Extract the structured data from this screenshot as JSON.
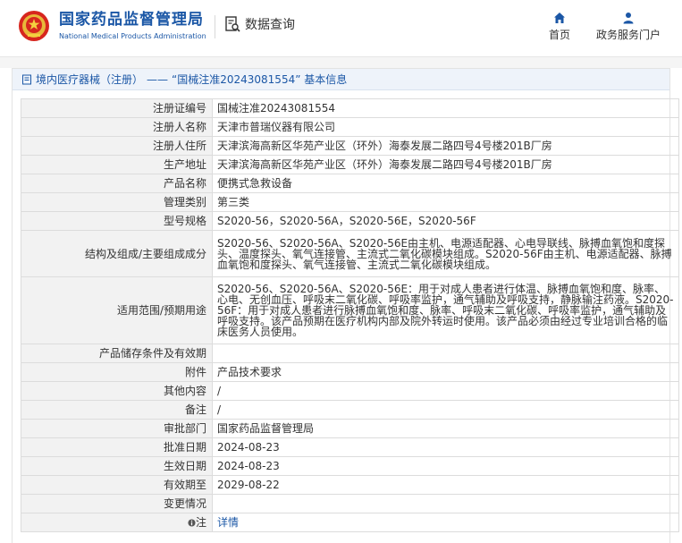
{
  "header": {
    "site_name_cn": "国家药品监督管理局",
    "site_name_en": "National Medical Products Administration",
    "query_label": "数据查询",
    "nav": [
      {
        "label": "首页",
        "icon": "home-icon"
      },
      {
        "label": "政务服务门户",
        "icon": "user-icon"
      }
    ],
    "brand_color": "#1b57a6"
  },
  "breadcrumb": {
    "category": "境内医疗器械（注册）",
    "separator": "——",
    "title": "“国械注准20243081554” 基本信息"
  },
  "record": {
    "rows": [
      {
        "label": "注册证编号",
        "value": "国械注准20243081554"
      },
      {
        "label": "注册人名称",
        "value": "天津市普瑞仪器有限公司"
      },
      {
        "label": "注册人住所",
        "value": "天津滨海高新区华苑产业区（环外）海泰发展二路四号4号楼201B厂房"
      },
      {
        "label": "生产地址",
        "value": "天津滨海高新区华苑产业区（环外）海泰发展二路四号4号楼201B厂房"
      },
      {
        "label": "产品名称",
        "value": "便携式急救设备"
      },
      {
        "label": "管理类别",
        "value": "第三类"
      },
      {
        "label": "型号规格",
        "value": "S2020-56，S2020-56A，S2020-56E，S2020-56F"
      },
      {
        "label": "结构及组成/主要组成成分",
        "value": "S2020-56、S2020-56A、S2020-56E由主机、电源适配器、心电导联线、脉搏血氧饱和度探头、温度探头、氧气连接管、主流式二氧化碳模块组成。S2020-56F由主机、电源适配器、脉搏血氧饱和度探头、氧气连接管、主流式二氧化碳模块组成。"
      },
      {
        "label": "适用范围/预期用途",
        "value": "S2020-56、S2020-56A、S2020-56E：用于对成人患者进行体温、脉搏血氧饱和度、脉率、心电、无创血压、呼吸末二氧化碳、呼吸率监护，通气辅助及呼吸支持，静脉输注药液。S2020-56F：用于对成人患者进行脉搏血氧饱和度、脉率、呼吸末二氧化碳、呼吸率监护，通气辅助及呼吸支持。该产品预期在医疗机构内部及院外转运时使用。该产品必须由经过专业培训合格的临床医务人员使用。"
      },
      {
        "label": "产品储存条件及有效期",
        "value": ""
      },
      {
        "label": "附件",
        "value": "产品技术要求"
      },
      {
        "label": "其他内容",
        "value": "/"
      },
      {
        "label": "备注",
        "value": "/"
      },
      {
        "label": "审批部门",
        "value": "国家药品监督管理局"
      },
      {
        "label": "批准日期",
        "value": "2024-08-23"
      },
      {
        "label": "生效日期",
        "value": "2024-08-23"
      },
      {
        "label": "有效期至",
        "value": "2029-08-22"
      },
      {
        "label": "变更情况",
        "value": ""
      },
      {
        "label": "注",
        "value": "详情"
      }
    ]
  }
}
